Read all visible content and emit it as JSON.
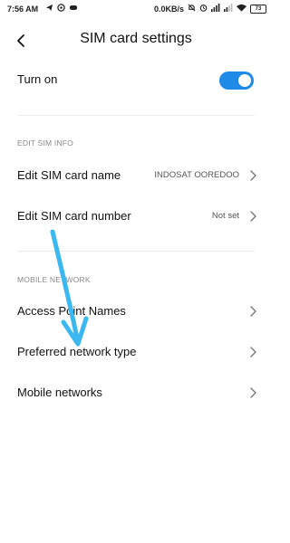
{
  "status_bar": {
    "time": "7:56 AM",
    "network_speed": "0.0KB/s",
    "battery": "73",
    "left_icons": [
      "telegram-icon",
      "whatsapp-icon",
      "game-icon"
    ],
    "right_icons": [
      "mute-icon",
      "alarm-icon",
      "signal-icon",
      "signal-icon",
      "wifi-icon"
    ]
  },
  "header": {
    "title": "SIM card settings",
    "back_icon": "chevron-left-icon"
  },
  "turn_on": {
    "label": "Turn on",
    "state": "on",
    "accent_color": "#1f8ae8"
  },
  "sections": {
    "edit_sim_info": "EDIT SIM INFO",
    "mobile_network": "MOBILE NETWORK"
  },
  "rows": {
    "sim_name": {
      "label": "Edit SIM card name",
      "value": "INDOSAT OOREDOO"
    },
    "sim_number": {
      "label": "Edit SIM card number",
      "value": "Not set"
    },
    "apn": {
      "label": "Access Point Names"
    },
    "preferred": {
      "label": "Preferred network type"
    },
    "mobile_networks": {
      "label": "Mobile networks"
    }
  },
  "annotation": {
    "arrow_color": "#3bb8f0",
    "points_to": "Preferred network type"
  }
}
